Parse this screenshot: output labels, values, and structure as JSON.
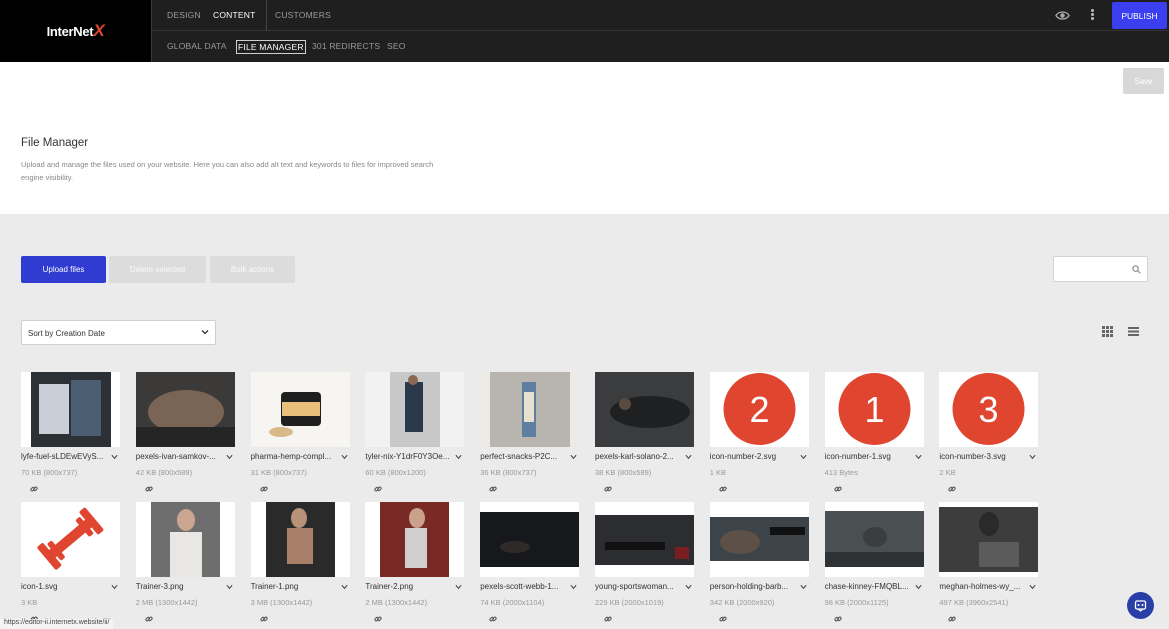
{
  "brand": {
    "name_main": "InterNet",
    "name_x": "X"
  },
  "nav": {
    "row1": [
      "DESIGN",
      "CONTENT",
      "CUSTOMERS"
    ],
    "row2": [
      "GLOBAL DATA",
      "FILE MANAGER",
      "301 REDIRECTS",
      "SEO"
    ],
    "publish_label": "PUBLISH"
  },
  "page": {
    "save_label": "Save",
    "title": "File Manager",
    "description": "Upload and manage the files used on your website. Here you can also add alt text and keywords to files for improved search engine visibility."
  },
  "toolbar": {
    "upload_label": "Upload files",
    "delete_label": "Delete selected",
    "bulk_label": "Bulk actions",
    "search_placeholder": "",
    "sort_value": "Sort by Creation Date"
  },
  "files": [
    {
      "name": "lyfe-fuel-sLDEwEVyS...",
      "meta": "70 KB (800x737)"
    },
    {
      "name": "pexels-ivan-samkov-...",
      "meta": "42 KB (800x589)"
    },
    {
      "name": "pharma-hemp-compl...",
      "meta": "31 KB (800x737)"
    },
    {
      "name": "tyler-nix-Y1drF0Y3Oe...",
      "meta": "60 KB (800x1200)"
    },
    {
      "name": "perfect-snacks-P2C...",
      "meta": "36 KB (800x737)"
    },
    {
      "name": "pexels-karl-solano-2...",
      "meta": "38 KB (800x589)"
    },
    {
      "name": "icon-number-2.svg",
      "meta": "1 KB",
      "digit": "2"
    },
    {
      "name": "icon-number-1.svg",
      "meta": "413 Bytes",
      "digit": "1"
    },
    {
      "name": "icon-number-3.svg",
      "meta": "2 KB",
      "digit": "3"
    },
    {
      "name": "icon-1.svg",
      "meta": "3 KB"
    },
    {
      "name": "Trainer-3.png",
      "meta": "2 MB (1300x1442)"
    },
    {
      "name": "Trainer-1.png",
      "meta": "3 MB (1300x1442)"
    },
    {
      "name": "Trainer-2.png",
      "meta": "2 MB (1300x1442)"
    },
    {
      "name": "pexels-scott-webb-1...",
      "meta": "74 KB (2000x1104)"
    },
    {
      "name": "young-sportswoman...",
      "meta": "229 KB (2000x1019)"
    },
    {
      "name": "person-holding-barb...",
      "meta": "342 KB (2000x920)"
    },
    {
      "name": "chase-kinney-FMQBL...",
      "meta": "98 KB (2000x1125)"
    },
    {
      "name": "meghan-holmes-wy_...",
      "meta": "497 KB (3960x2541)"
    }
  ],
  "status_url": "https://editor-ii.internetx.website/ii/",
  "colors": {
    "accent": "#3b3ff0",
    "upload": "#2f3bd1",
    "badge": "#e0452f"
  }
}
